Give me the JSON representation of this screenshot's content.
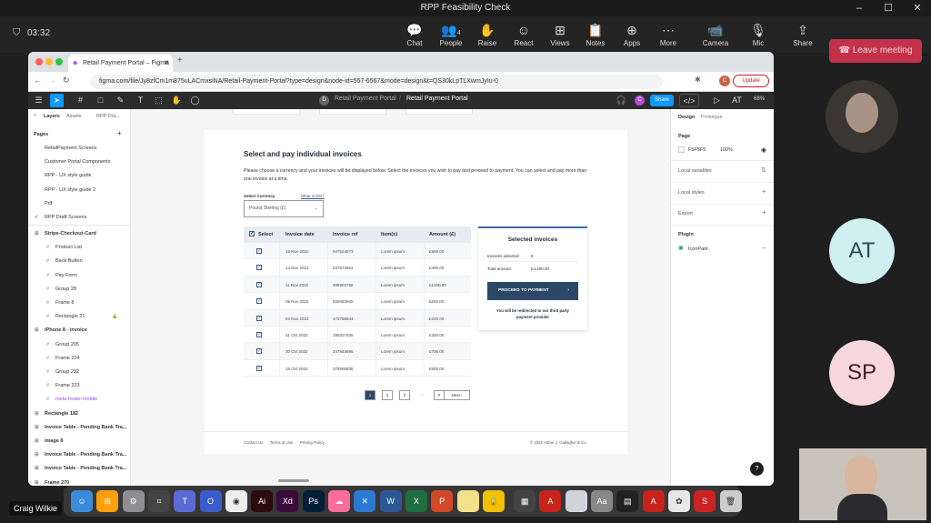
{
  "window_title": "RPP Feasibility Check",
  "meeting": {
    "timer": "03:32",
    "controls": [
      {
        "label": "Chat",
        "icon": "chat-icon"
      },
      {
        "label": "People",
        "icon": "people-icon",
        "badge": "4"
      },
      {
        "label": "Raise",
        "icon": "raise-hand-icon"
      },
      {
        "label": "React",
        "icon": "react-icon"
      },
      {
        "label": "Views",
        "icon": "views-icon"
      },
      {
        "label": "Notes",
        "icon": "notes-icon"
      },
      {
        "label": "Apps",
        "icon": "apps-icon"
      },
      {
        "label": "More",
        "icon": "more-icon"
      },
      {
        "label": "Camera",
        "icon": "camera-icon"
      },
      {
        "label": "Mic",
        "icon": "mic-icon"
      },
      {
        "label": "Share",
        "icon": "share-icon"
      }
    ],
    "leave_label": "Leave meeting",
    "participants": [
      {
        "initials": "AT",
        "color": "#cfeff0",
        "text": "#2d4b57"
      },
      {
        "initials": "SP",
        "color": "#f6d7dc",
        "text": "#3d2228"
      }
    ],
    "presenter_name": "Craig Wilkie"
  },
  "browser": {
    "tab_title": "Retail Payment Portal – Figma",
    "url": "figma.com/file/Jy8zfCm1m875uLACmxsiNA/Retail-Payment-Portal?type=design&node-id=557-6567&mode=design&t=QS30kLpTLXwmJyIu-0",
    "update_label": "Update"
  },
  "figma": {
    "breadcrumb_project": "Retail Payment Portal",
    "breadcrumb_file": "Retail Payment Portal",
    "share_label": "Share",
    "zoom": "68%",
    "left_tabs": [
      "Layers",
      "Assets",
      "RPP Dra..."
    ],
    "pages_label": "Pages",
    "pages": [
      "RetailPayment Screens",
      "Customer Portal Components",
      "RPP - UX style guide",
      "RPP - UX style guide 2",
      "Pdf",
      "RPP Draft Screens"
    ],
    "layers": [
      {
        "name": "Stripe-Checkout-Card",
        "indent": 0
      },
      {
        "name": "Product List",
        "indent": 1
      },
      {
        "name": "Back Button",
        "indent": 1
      },
      {
        "name": "Pay Form",
        "indent": 1
      },
      {
        "name": "Group 28",
        "indent": 1
      },
      {
        "name": "Frame 8",
        "indent": 1
      },
      {
        "name": "Rectangle 21",
        "indent": 1
      },
      {
        "name": "iPhone 8 - invoice",
        "indent": 0
      },
      {
        "name": "Group 205",
        "indent": 1
      },
      {
        "name": "Frame 224",
        "indent": 1
      },
      {
        "name": "Group 232",
        "indent": 1
      },
      {
        "name": "Frame 223",
        "indent": 1
      },
      {
        "name": "meta-footer-mobile",
        "indent": 1
      },
      {
        "name": "Rectangle 182",
        "indent": 0
      },
      {
        "name": "Invoice Table - Pending Bank Tra...",
        "indent": 0
      },
      {
        "name": "image 8",
        "indent": 0
      },
      {
        "name": "Invoice Table - Pending Bank Tra...",
        "indent": 0
      },
      {
        "name": "Invoice Table - Pending Bank Tra...",
        "indent": 0
      },
      {
        "name": "Frame 270",
        "indent": 0
      }
    ],
    "right_tabs": [
      "Design",
      "Prototype"
    ],
    "page_section": "Page",
    "page_color": "F5F5F5",
    "page_opacity": "100%",
    "local_variables": "Local variables",
    "local_styles": "Local styles",
    "export": "Export",
    "plugin_section": "Plugin",
    "plugin_name": "IconPark"
  },
  "design": {
    "heading": "Select and pay individual invoices",
    "description": "Please choose a currency and your invoices will be displayed below. Select the invoices you wish to pay and proceed to payment. You can select and pay more than one invoice at a time.",
    "currency_label": "Select Currency",
    "whats_this": "What is this?",
    "currency_value": "Pound Sterling (£)",
    "table_headers": [
      "Select",
      "Invoice date",
      "Invoice ref",
      "Item(s)",
      "Amount (£)"
    ],
    "rows": [
      {
        "date": "15 Nov 2022",
        "ref": "947524573",
        "item": "Lorem ipsum",
        "amount": "£500.00"
      },
      {
        "date": "14 Nov 2022",
        "ref": "537573554",
        "item": "Lorem ipsum",
        "amount": "£400.00"
      },
      {
        "date": "11 Nov 2022",
        "ref": "385903758",
        "item": "Lorem ipsum",
        "amount": "£1000.00"
      },
      {
        "date": "05 Nov 2022",
        "ref": "929453945",
        "item": "Lorem ipsum",
        "amount": "£600.00"
      },
      {
        "date": "02 Nov 2022",
        "ref": "473758644",
        "item": "Lorem ipsum",
        "amount": "£200.00"
      },
      {
        "date": "31 Oct 2022",
        "ref": "195327535",
        "item": "Lorem ipsum",
        "amount": "£300.00"
      },
      {
        "date": "30 Oct 2022",
        "ref": "347845895",
        "item": "Lorem ipsum",
        "amount": "£700.00"
      },
      {
        "date": "15 Oct 2022",
        "ref": "378586835",
        "item": "Lorem ipsum",
        "amount": "£500.00"
      }
    ],
    "summary_title": "Selected invoices",
    "invoices_selected_label": "Invoices selected:",
    "invoices_selected_value": "8",
    "total_label": "Total amount:",
    "total_value": "£4,200.00",
    "proceed_label": "PROCEED TO PAYMENT",
    "redirect_note": "You will be redirected to our third party payment provider",
    "pagination": [
      "1",
      "2",
      "3",
      "...",
      "#"
    ],
    "next_label": "Next",
    "footer_links": [
      "Contact Us",
      "Terms of Use",
      "Privacy Policy"
    ],
    "copyright": "© 2022 Arthur J. Gallagher & Co."
  },
  "colors": {
    "teams_bg": "#1f1f1f",
    "leave_red": "#c4314b",
    "figma_blue": "#0d99ff",
    "navy": "#2c4866"
  }
}
